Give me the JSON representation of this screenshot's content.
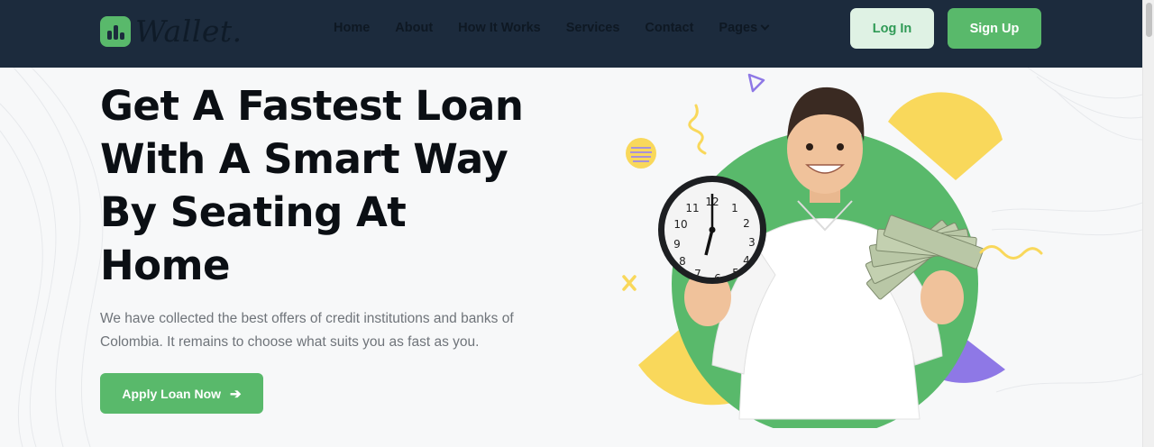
{
  "brand": {
    "name": "Wallet",
    "dot": "."
  },
  "nav": {
    "items": [
      {
        "label": "Home"
      },
      {
        "label": "About"
      },
      {
        "label": "How It Works"
      },
      {
        "label": "Services"
      },
      {
        "label": "Contact"
      },
      {
        "label": "Pages"
      }
    ],
    "login_label": "Log In",
    "signup_label": "Sign Up"
  },
  "hero": {
    "title_lines": [
      "Get A Fastest Loan",
      "With A Smart Way",
      "By Seating At",
      "Home"
    ],
    "description": "We have collected the best offers of credit institutions and banks of Colombia. It remains to choose what suits you as fast as you.",
    "cta_label": "Apply Loan Now"
  },
  "clock": {
    "numbers": [
      "12",
      "1",
      "2",
      "3",
      "4",
      "5",
      "6",
      "7",
      "8",
      "9",
      "10",
      "11"
    ]
  },
  "colors": {
    "navbar_bg": "#1c2b3d",
    "accent_green": "#59b96b",
    "accent_yellow": "#f9d85b",
    "accent_purple": "#8e78e6",
    "text_dark": "#0b0f14"
  },
  "icons": {
    "logo": "bar-chart-icon",
    "pages_dropdown": "chevron-down-icon",
    "cta_arrow": "arrow-right-icon"
  }
}
